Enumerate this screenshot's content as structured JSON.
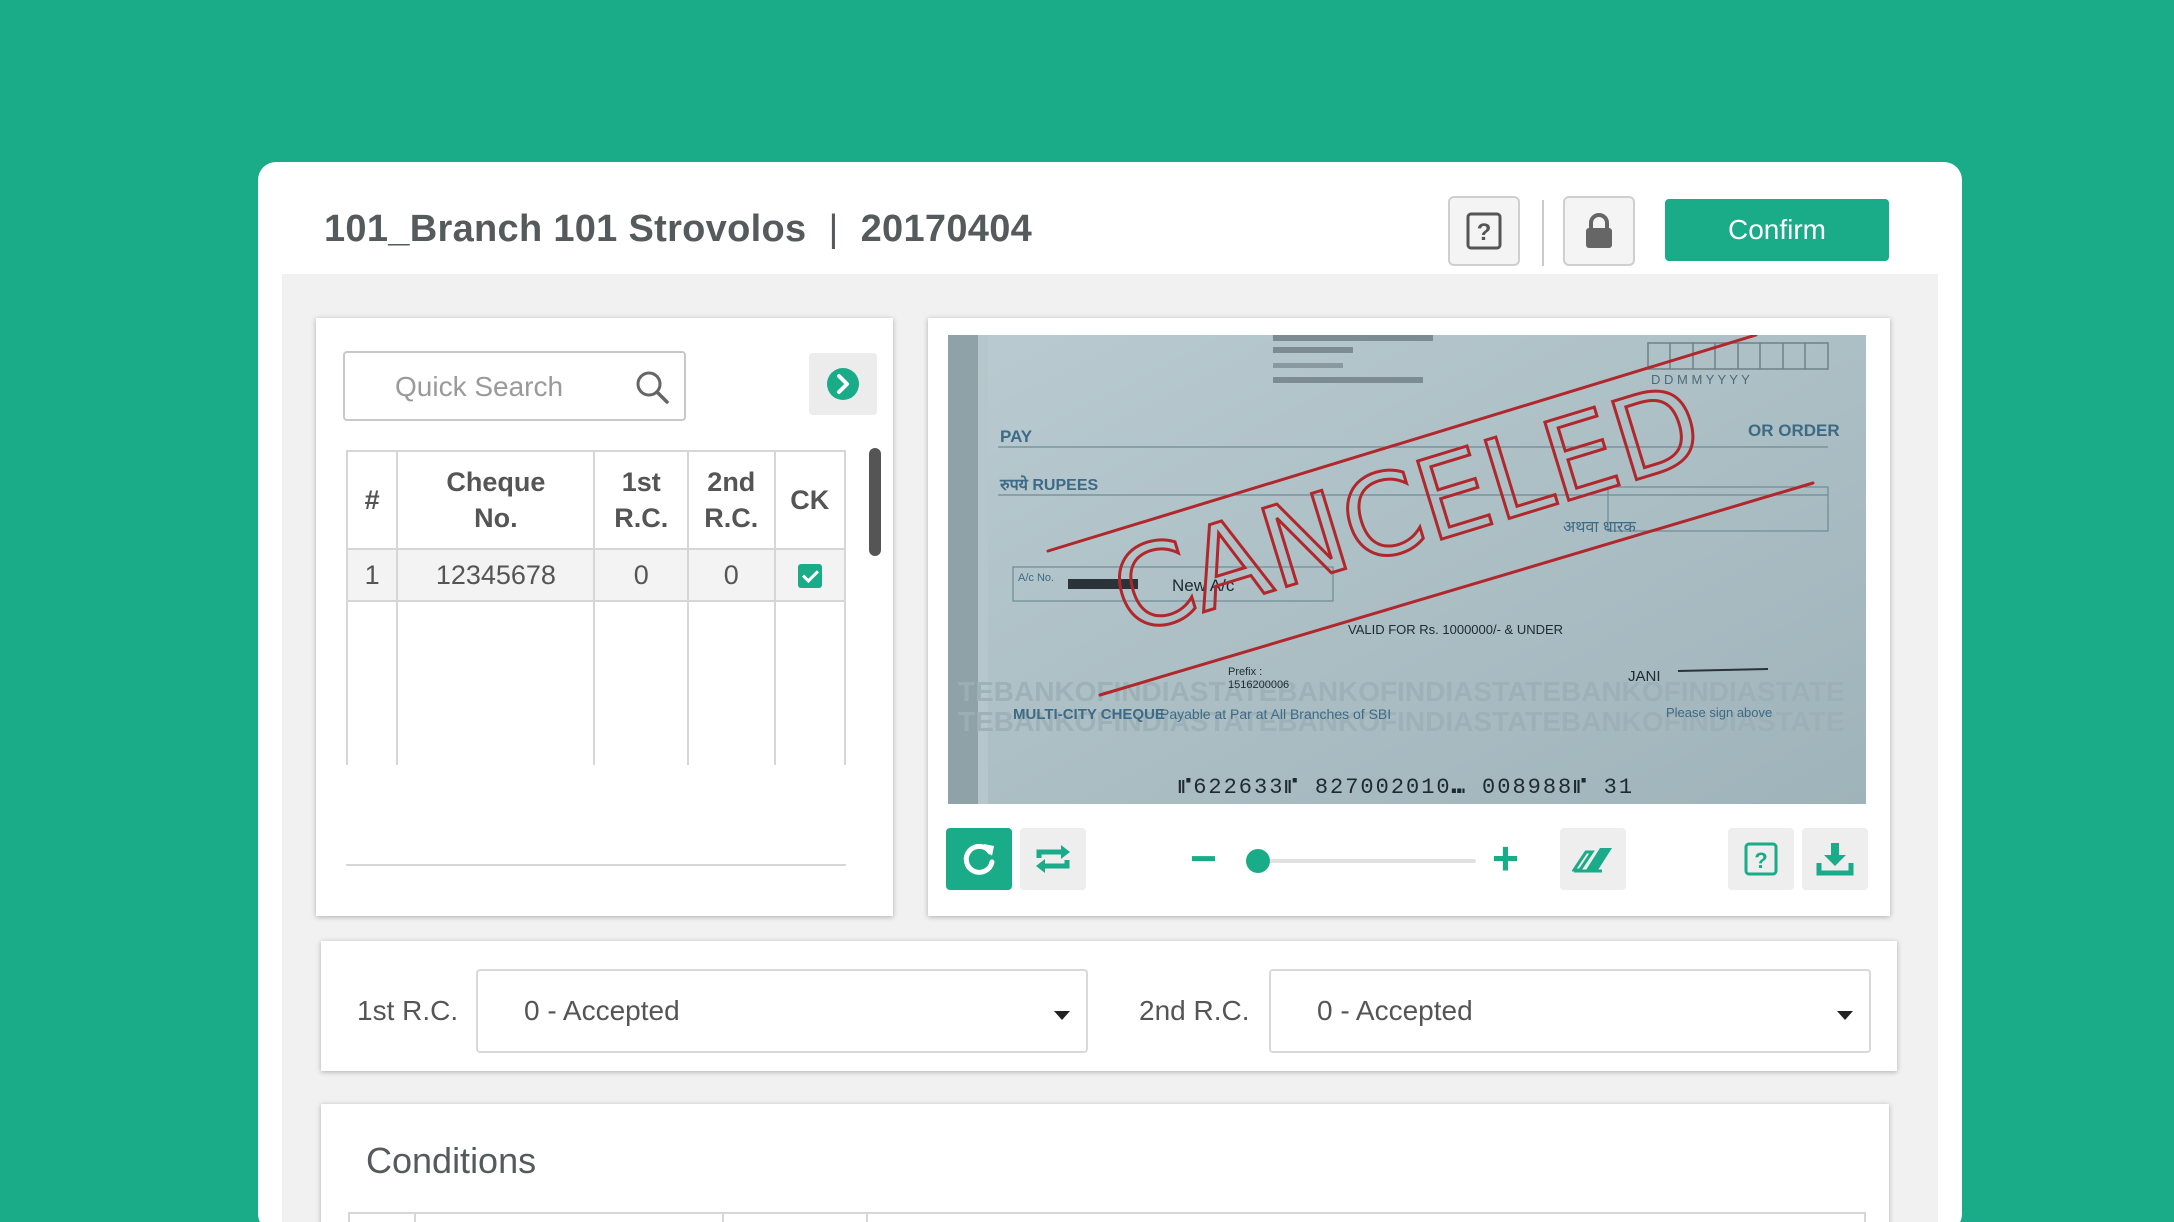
{
  "header": {
    "branch": "101_Branch 101 Strovolos",
    "separator": "|",
    "date": "20170404",
    "confirm_label": "Confirm"
  },
  "search": {
    "placeholder": "Quick Search"
  },
  "table": {
    "headers": [
      "#",
      "Cheque No.",
      "1st R.C.",
      "2nd R.C.",
      "CK"
    ],
    "rows": [
      {
        "num": "1",
        "cheque": "12345678",
        "rc1": "0",
        "rc2": "0",
        "ck": true
      }
    ]
  },
  "cheque_image": {
    "stamp": "CANCELED",
    "pay": "PAY",
    "or_order": "OR ORDER",
    "rupees": "रुपये RUPEES",
    "date_fmt": "D D M M Y Y Y Y",
    "acno": "A/c No.",
    "new_ac": "New A/c",
    "valid": "VALID FOR Rs. 1000000/- & UNDER",
    "prefix": "Prefix :",
    "prefix_no": "1516200006",
    "multicity": "MULTI-CITY CHEQUE",
    "payable": "Payable at Par at All Branches of SBI",
    "sign": "Please sign above",
    "micr": "⑈622633⑈ 827002010⑉ 008988⑈ 31",
    "bearer": "अथवा धारक",
    "jani": "JANI"
  },
  "toolbar": {
    "icons": [
      "refresh-icon",
      "rotate-icon",
      "zoom-out-icon",
      "zoom-in-icon",
      "eraser-icon",
      "help-icon",
      "download-icon"
    ],
    "minus": "−",
    "plus": "+",
    "zoom_fraction": 0.0
  },
  "rc": {
    "first_label": "1st R.C.",
    "first_value": "0 - Accepted",
    "second_label": "2nd R.C.",
    "second_value": "0 - Accepted"
  },
  "conditions": {
    "title": "Conditions"
  },
  "colors": {
    "accent": "#1aab89",
    "background": "#1aab89",
    "stamp": "#b0272c"
  }
}
